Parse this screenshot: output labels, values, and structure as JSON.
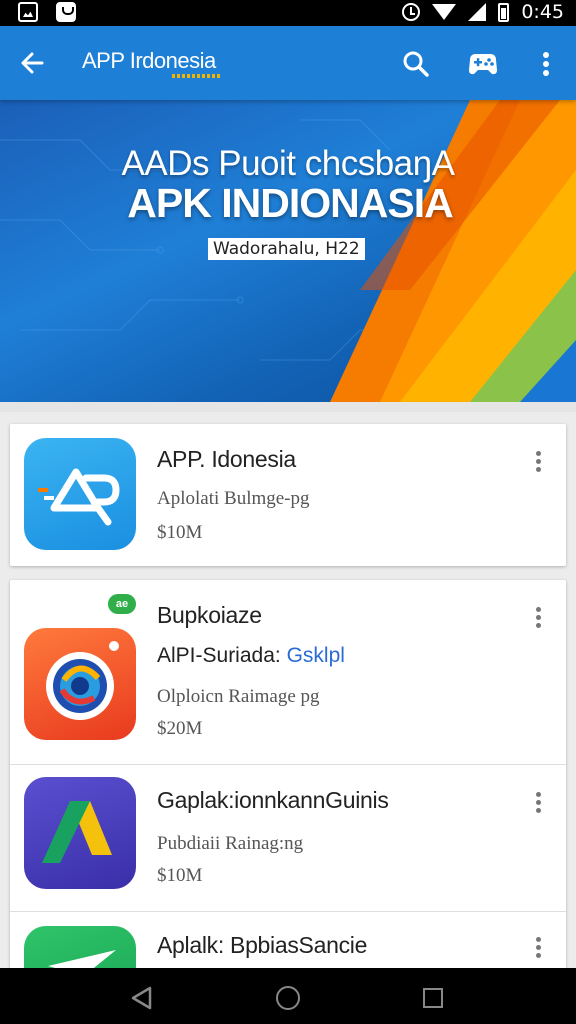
{
  "status_bar": {
    "time": "0:45",
    "left_icons": [
      "gallery-icon",
      "shop-icon"
    ],
    "right_icons": [
      "alarm-icon",
      "wifi-icon",
      "signal-icon",
      "battery-icon"
    ]
  },
  "app_bar": {
    "title": "APP Irdonesia",
    "icons": [
      "back-arrow-icon",
      "search-icon",
      "gamepad-icon",
      "more-vert-icon"
    ],
    "color": "#1d7fd6"
  },
  "banner": {
    "line1": "AADs Puoit chcsbaŋA",
    "line2": "APK INDIONASIA",
    "badge": "Wadorahalu, H22",
    "accent_colors": [
      "#f57c00",
      "#ffa000",
      "#8bc34a",
      "#1976d2"
    ]
  },
  "apps": [
    {
      "name": "APP. Idonesia",
      "meta": "Aplolati Bulmge-pg",
      "price": "$10M",
      "icon": "ap-logo-icon"
    },
    {
      "name": "Bupkoiaze",
      "subtitle": "AlPI-Suriada:",
      "subtitle_link": "Gsklpl",
      "meta": "Olploicn Raimage pg",
      "price": "$20M",
      "icon": "camera-lens-icon",
      "badge": "ae"
    },
    {
      "name": "Gaplak:ionnkannGuinis",
      "meta": "Pubdiaii Rainag:ng",
      "price": "$10M",
      "icon": "triangle-drive-icon"
    },
    {
      "name": "Aplalk: BpbiasSancie",
      "icon": "green-send-icon"
    }
  ],
  "nav_bar": {
    "icons": [
      "nav-back-icon",
      "nav-home-icon",
      "nav-recents-icon"
    ]
  }
}
